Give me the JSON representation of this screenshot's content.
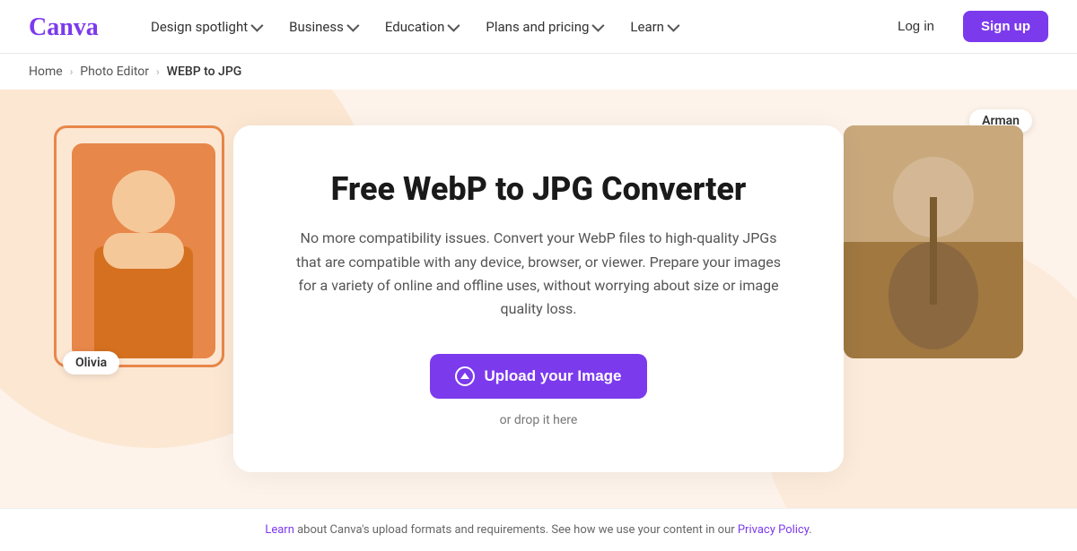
{
  "nav": {
    "logo_alt": "Canva",
    "items": [
      {
        "id": "design-spotlight",
        "label": "Design spotlight",
        "has_chevron": true
      },
      {
        "id": "business",
        "label": "Business",
        "has_chevron": true
      },
      {
        "id": "education",
        "label": "Education",
        "has_chevron": true
      },
      {
        "id": "plans-pricing",
        "label": "Plans and pricing",
        "has_chevron": true
      },
      {
        "id": "learn",
        "label": "Learn",
        "has_chevron": true
      }
    ],
    "login_label": "Log in",
    "signup_label": "Sign up"
  },
  "breadcrumb": {
    "items": [
      {
        "id": "home",
        "label": "Home",
        "href": "#"
      },
      {
        "id": "photo-editor",
        "label": "Photo Editor",
        "href": "#"
      },
      {
        "id": "current",
        "label": "WEBP to JPG"
      }
    ]
  },
  "hero": {
    "title": "Free WebP to JPG Converter",
    "description": "No more compatibility issues. Convert your WebP files to high-quality JPGs that are compatible with any device, browser, or viewer. Prepare your images for a variety of online and offline uses, without worrying about size or image quality loss.",
    "upload_label": "Upload your Image",
    "drop_label": "or drop it here",
    "label_left": "Olivia",
    "label_right": "Arman"
  },
  "footer": {
    "text_before": "Learn",
    "text_middle": " about Canva's upload formats and requirements. See how we use your content in our ",
    "privacy_label": "Privacy Policy",
    "text_end": ".",
    "learn_href": "#",
    "privacy_href": "#"
  },
  "colors": {
    "purple": "#7c3aed",
    "hero_bg": "#fdf3ea"
  }
}
